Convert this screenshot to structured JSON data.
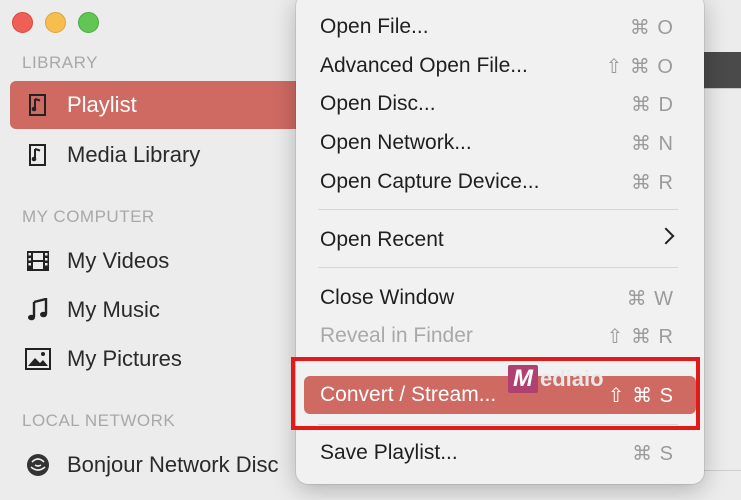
{
  "window": {
    "traffic_lights": [
      "close",
      "minimize",
      "zoom"
    ]
  },
  "sidebar": {
    "sections": [
      {
        "heading": "LIBRARY",
        "items": [
          {
            "label": "Playlist",
            "icon": "playlist-icon",
            "selected": true
          },
          {
            "label": "Media Library",
            "icon": "media-library-icon",
            "selected": false
          }
        ]
      },
      {
        "heading": "MY COMPUTER",
        "items": [
          {
            "label": "My Videos",
            "icon": "film-icon"
          },
          {
            "label": "My Music",
            "icon": "music-note-icon"
          },
          {
            "label": "My Pictures",
            "icon": "picture-icon"
          }
        ]
      },
      {
        "heading": "LOCAL NETWORK",
        "items": [
          {
            "label": "Bonjour Network Disc",
            "icon": "bonjour-icon"
          }
        ]
      }
    ]
  },
  "menu": {
    "items": [
      {
        "label": "Open File...",
        "shortcut": "⌘ O"
      },
      {
        "label": "Advanced Open File...",
        "shortcut": "⇧ ⌘ O"
      },
      {
        "label": "Open Disc...",
        "shortcut": "⌘ D"
      },
      {
        "label": "Open Network...",
        "shortcut": "⌘ N"
      },
      {
        "label": "Open Capture Device...",
        "shortcut": "⌘ R"
      },
      {
        "label": "Open Recent",
        "submenu": true
      },
      {
        "label": "Close Window",
        "shortcut": "⌘ W"
      },
      {
        "label": "Reveal in Finder",
        "shortcut": "⇧ ⌘ R",
        "disabled": true
      },
      {
        "label": "Convert / Stream...",
        "shortcut": "⇧ ⌘ S",
        "highlighted": true
      },
      {
        "label": "Save Playlist...",
        "shortcut": "⌘ S"
      }
    ]
  },
  "watermark": {
    "letter": "M",
    "text": "ediaio"
  },
  "colors": {
    "accent": "#cf6a63",
    "highlight_box": "#e21a1a"
  }
}
